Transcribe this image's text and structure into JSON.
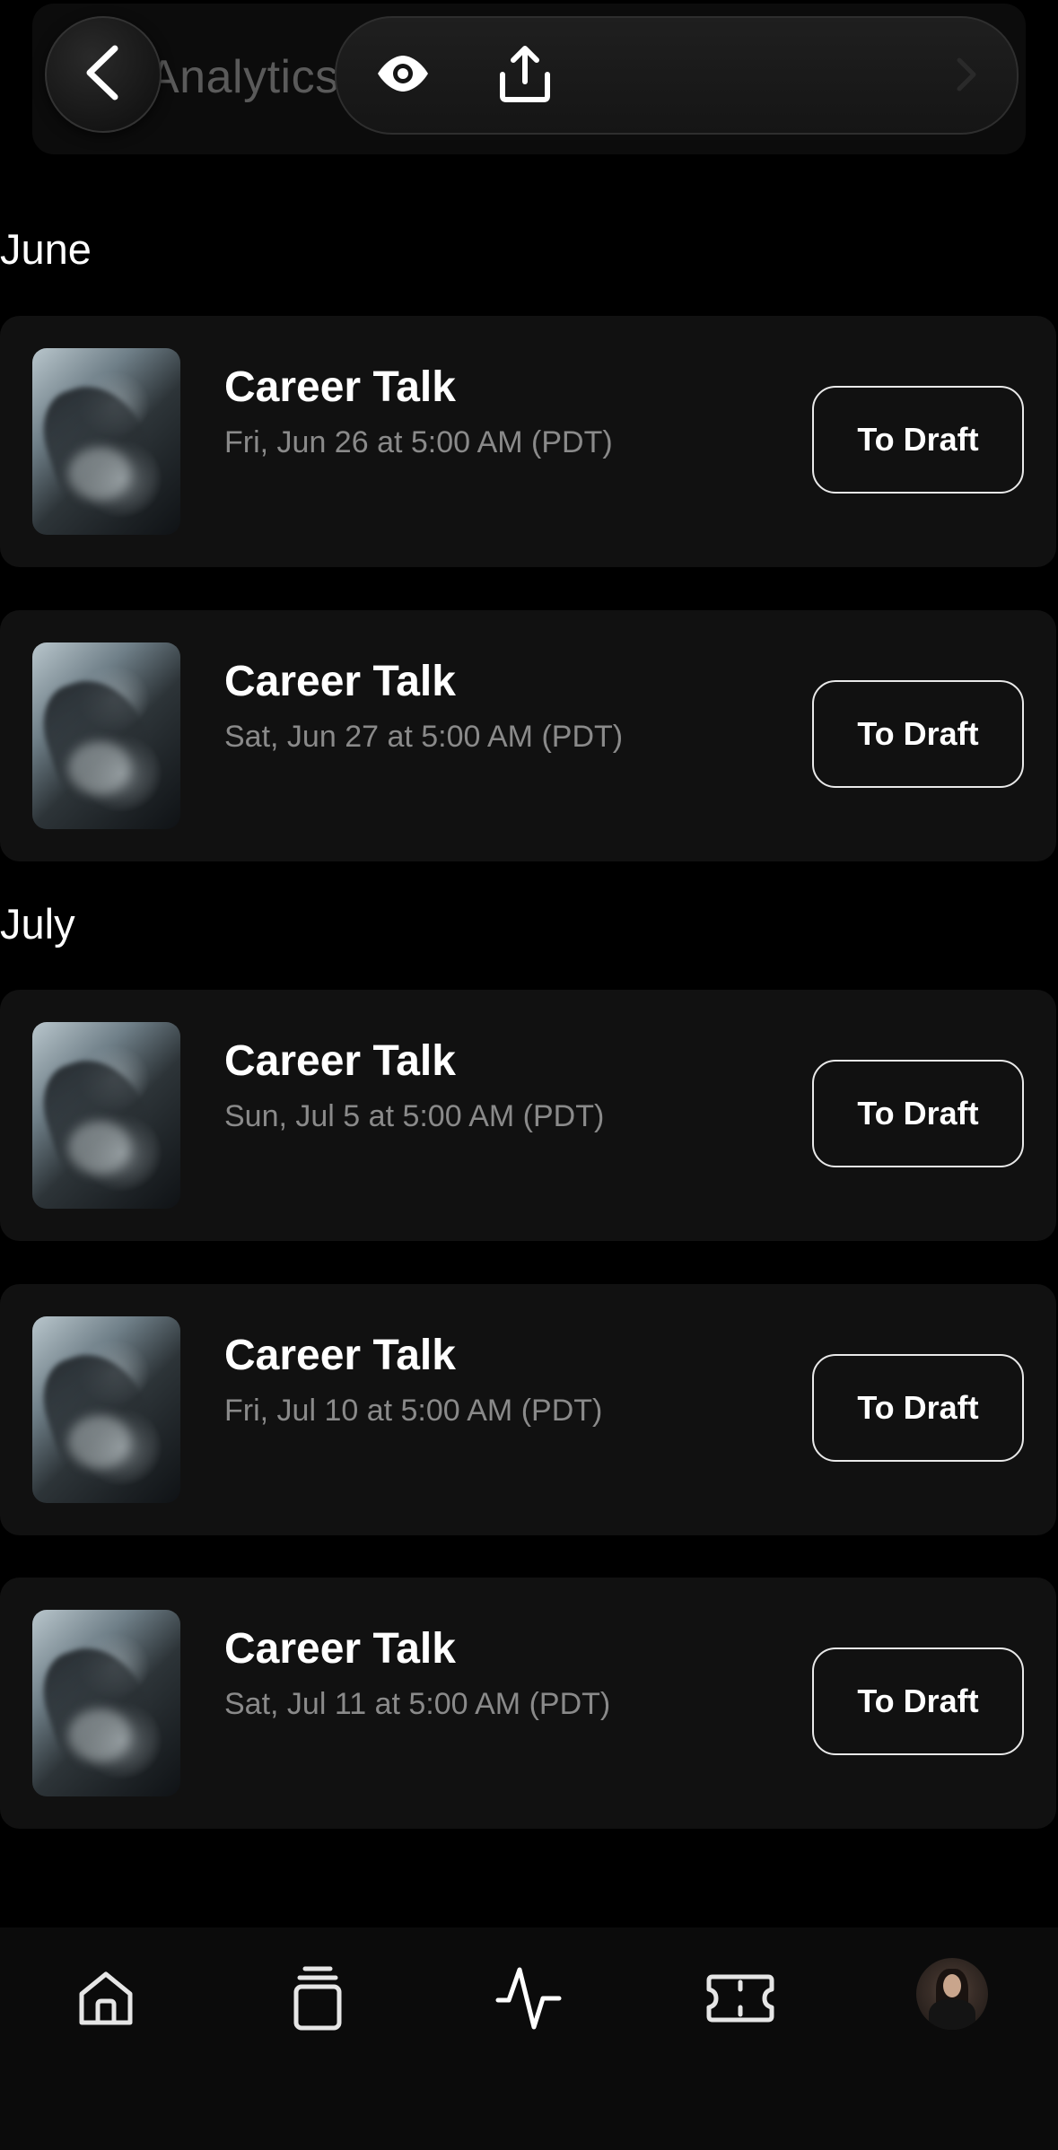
{
  "header": {
    "faded_title": "Analytics",
    "back_icon": "chevron-left-icon",
    "preview_icon": "eye-icon",
    "share_icon": "share-upload-icon",
    "forward_icon": "chevron-right-icon"
  },
  "sections": [
    {
      "month": "June",
      "events": [
        {
          "title": "Career Talk",
          "date": "Fri, Jun 26 at 5:00 AM (PDT)",
          "action": "To Draft"
        },
        {
          "title": "Career Talk",
          "date": "Sat, Jun 27 at 5:00 AM (PDT)",
          "action": "To Draft"
        }
      ]
    },
    {
      "month": "July",
      "events": [
        {
          "title": "Career Talk",
          "date": "Sun, Jul 5 at 5:00 AM (PDT)",
          "action": "To Draft"
        },
        {
          "title": "Career Talk",
          "date": "Fri, Jul 10 at 5:00 AM (PDT)",
          "action": "To Draft"
        },
        {
          "title": "Career Talk",
          "date": "Sat, Jul 11 at 5:00 AM (PDT)",
          "action": "To Draft"
        }
      ]
    }
  ],
  "bottom_nav": {
    "items": [
      {
        "icon": "home-icon"
      },
      {
        "icon": "stack-icon"
      },
      {
        "icon": "activity-icon"
      },
      {
        "icon": "ticket-icon"
      },
      {
        "icon": "profile-avatar"
      }
    ]
  },
  "colors": {
    "background": "#000000",
    "card": "#111111",
    "muted_text": "#8a8a8a",
    "text": "#ffffff"
  }
}
